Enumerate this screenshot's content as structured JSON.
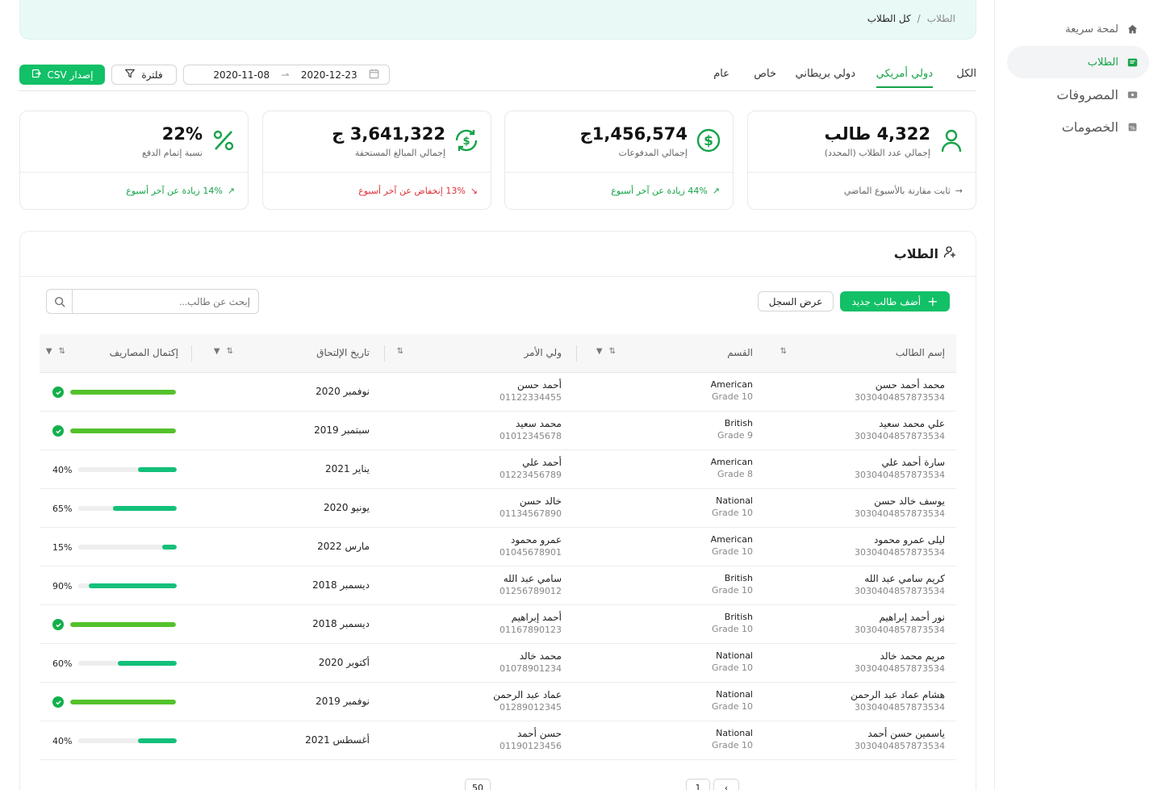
{
  "sidebar": {
    "items": [
      {
        "label": "لمحة سريعة",
        "icon": "home-icon"
      },
      {
        "label": "الطلاب",
        "icon": "id-card-icon",
        "active": true
      },
      {
        "label": "المصروفات",
        "icon": "cash-icon"
      },
      {
        "label": "الخصومات",
        "icon": "discount-icon"
      }
    ]
  },
  "breadcrumb": {
    "parent": "الطلاب",
    "sep": "/",
    "current": "كل الطلاب"
  },
  "tabs": [
    "الكل",
    "دولي أمريكي",
    "دولي بريطاني",
    "خاص",
    "عام"
  ],
  "toolbar": {
    "export_label": "إصدار CSV",
    "filter_label": "فلترة",
    "date_from": "2020-12-23",
    "date_to": "2020-11-08"
  },
  "cards": [
    {
      "value": "4,322 طالب",
      "label": "إجمالي عدد الطلاب (المحدد)",
      "foot": "ثابت مقارنة بالأسبوع الماضي",
      "trend": "neutral",
      "icon": "user-icon"
    },
    {
      "value": "1,456,574ج",
      "label": "إجمالي المدفوعات",
      "foot": "44% زيادة عن آخر أسبوع",
      "trend": "up",
      "icon": "dollar-icon"
    },
    {
      "value": "3,641,322 ج",
      "label": "إجمالي المبالغ المستحقة",
      "foot": "13% إنخفاض عن آخر أسبوع",
      "trend": "down",
      "icon": "refresh-dollar-icon"
    },
    {
      "value": "22%",
      "label": "نسبة إتمام الدفع",
      "foot": "14% زيادة عن آخر أسبوع",
      "trend": "up",
      "icon": "percent-icon"
    }
  ],
  "panel": {
    "title": "الطلاب",
    "add_label": "أضف طالب جديد",
    "log_label": "عرض السجل",
    "search_placeholder": "إبحث عن طالب..."
  },
  "table": {
    "headers": [
      "إسم الطالب",
      "القسم",
      "ولي الأمر",
      "تاريخ الإلتحاق",
      "إكتمال المصاريف"
    ],
    "rows": [
      {
        "name": "محمد أحمد حسن",
        "id": "3030404857873534",
        "dept": "American",
        "grade": "Grade 10",
        "guardian": "أحمد حسن",
        "phone": "01122334455",
        "date": "نوفمبر 2020",
        "progress": 100
      },
      {
        "name": "علي محمد سعيد",
        "id": "3030404857873534",
        "dept": "British",
        "grade": "Grade 9",
        "guardian": "محمد سعيد",
        "phone": "01012345678",
        "date": "سبتمبر 2019",
        "progress": 100
      },
      {
        "name": "سارة أحمد علي",
        "id": "3030404857873534",
        "dept": "American",
        "grade": "Grade 8",
        "guardian": "أحمد علي",
        "phone": "01223456789",
        "date": "يناير 2021",
        "progress": 40
      },
      {
        "name": "يوسف خالد حسن",
        "id": "3030404857873534",
        "dept": "National",
        "grade": "Grade 10",
        "guardian": "خالد حسن",
        "phone": "01134567890",
        "date": "يونيو 2020",
        "progress": 65
      },
      {
        "name": "ليلى عمرو محمود",
        "id": "3030404857873534",
        "dept": "American",
        "grade": "Grade 10",
        "guardian": "عمرو محمود",
        "phone": "01045678901",
        "date": "مارس 2022",
        "progress": 15
      },
      {
        "name": "كريم سامي عبد الله",
        "id": "3030404857873534",
        "dept": "British",
        "grade": "Grade 10",
        "guardian": "سامي عبد الله",
        "phone": "01256789012",
        "date": "ديسمبر 2018",
        "progress": 90
      },
      {
        "name": "نور أحمد إبراهيم",
        "id": "3030404857873534",
        "dept": "British",
        "grade": "Grade 10",
        "guardian": "أحمد إبراهيم",
        "phone": "01167890123",
        "date": "ديسمبر 2018",
        "progress": 100
      },
      {
        "name": "مريم محمد خالد",
        "id": "3030404857873534",
        "dept": "National",
        "grade": "Grade 10",
        "guardian": "محمد خالد",
        "phone": "01078901234",
        "date": "أكتوبر 2020",
        "progress": 60
      },
      {
        "name": "هشام عماد عبد الرحمن",
        "id": "3030404857873534",
        "dept": "National",
        "grade": "Grade 10",
        "guardian": "عماد عبد الرحمن",
        "phone": "01289012345",
        "date": "نوفمبر 2019",
        "progress": 100
      },
      {
        "name": "ياسمين حسن أحمد",
        "id": "3030404857873534",
        "dept": "National",
        "grade": "Grade 10",
        "guardian": "حسن أحمد",
        "phone": "01190123456",
        "date": "أغسطس 2021",
        "progress": 40
      }
    ]
  },
  "pager": {
    "current": "1",
    "page_size": "50"
  },
  "colors": {
    "accent": "#12c067",
    "done": "#12b04a",
    "bar_full": "#54c22b",
    "bar_partial": "#13c07a",
    "down": "#e0323a"
  }
}
